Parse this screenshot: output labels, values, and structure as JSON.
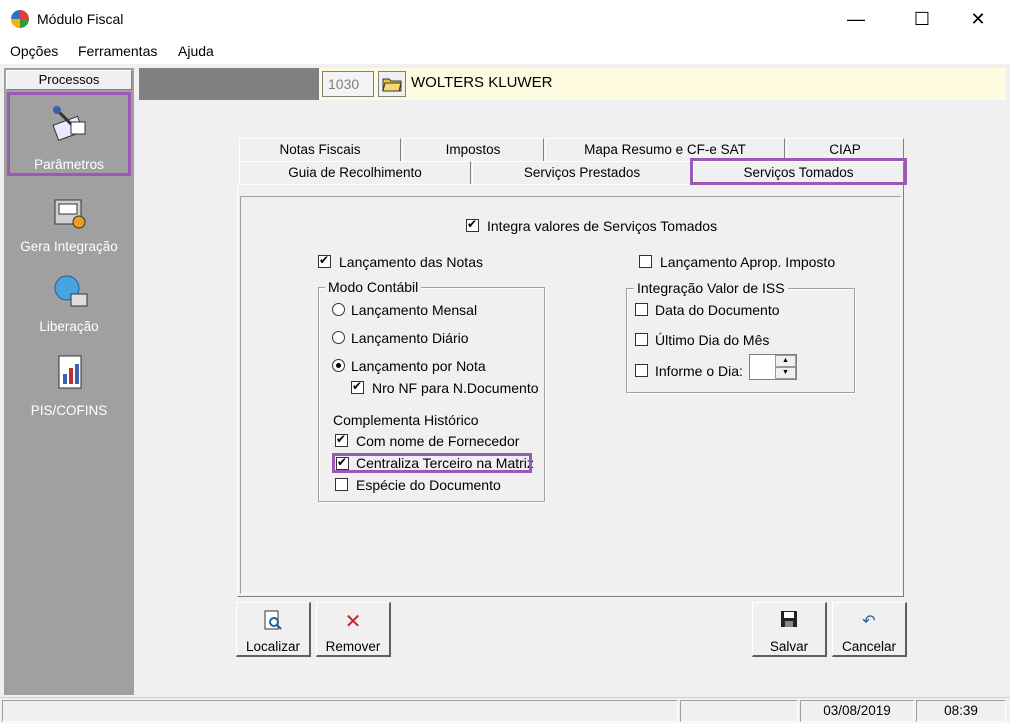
{
  "window": {
    "title": "Módulo Fiscal",
    "minimize": "—",
    "maximize": "☐",
    "close": "✕"
  },
  "menu": [
    {
      "label": "Opções"
    },
    {
      "label": "Ferramentas"
    },
    {
      "label": "Ajuda"
    }
  ],
  "sidebar": {
    "header": "Processos",
    "items": [
      {
        "label": "Parâmetros",
        "icon": "parameters-icon",
        "selected": true
      },
      {
        "label": "Gera Integração",
        "icon": "integration-icon"
      },
      {
        "label": "Liberação",
        "icon": "release-icon"
      },
      {
        "label": "PIS/COFINS",
        "icon": "pis-cofins-icon"
      }
    ]
  },
  "company": {
    "code": "1030",
    "name": "WOLTERS KLUWER"
  },
  "tabs": {
    "row1": [
      "Notas Fiscais",
      "Impostos",
      "Mapa Resumo e CF-e SAT",
      "CIAP"
    ],
    "row2": [
      "Guia de Recolhimento",
      "Serviços Prestados",
      "Serviços Tomados"
    ],
    "active": "Serviços Tomados"
  },
  "form": {
    "integra": {
      "label": "Integra valores de Serviços Tomados",
      "checked": true
    },
    "lancamento_notas": {
      "label": "Lançamento das Notas",
      "checked": true
    },
    "lancamento_aprop": {
      "label": "Lançamento Aprop. Imposto",
      "checked": false
    },
    "modo_contabil": {
      "title": "Modo Contábil",
      "options": [
        "Lançamento Mensal",
        "Lançamento Diário",
        "Lançamento por Nota"
      ],
      "selected": "Lançamento por Nota",
      "nro_nf": {
        "label": "Nro NF para N.Documento",
        "checked": true
      },
      "complementa_title": "Complementa Histórico",
      "com_nome": {
        "label": "Com nome de Fornecedor",
        "checked": true
      },
      "centraliza": {
        "label": "Centraliza Terceiro na Matriz",
        "checked": true
      },
      "especie": {
        "label": "Espécie do Documento",
        "checked": false
      }
    },
    "integracao_iss": {
      "title": "Integração Valor de ISS",
      "data_documento": {
        "label": "Data do Documento",
        "checked": false
      },
      "ultimo_dia": {
        "label": "Último Dia do Mês",
        "checked": false
      },
      "informe_dia": {
        "label": "Informe o Dia:",
        "checked": false,
        "value": ""
      }
    }
  },
  "buttons": {
    "localizar": "Localizar",
    "remover": "Remover",
    "salvar": "Salvar",
    "cancelar": "Cancelar"
  },
  "status": {
    "date": "03/08/2019",
    "time": "08:39"
  },
  "colors": {
    "highlight": "#9b59b6",
    "sidebar": "#a0a0a0",
    "company_bar": "#fffbe0"
  }
}
